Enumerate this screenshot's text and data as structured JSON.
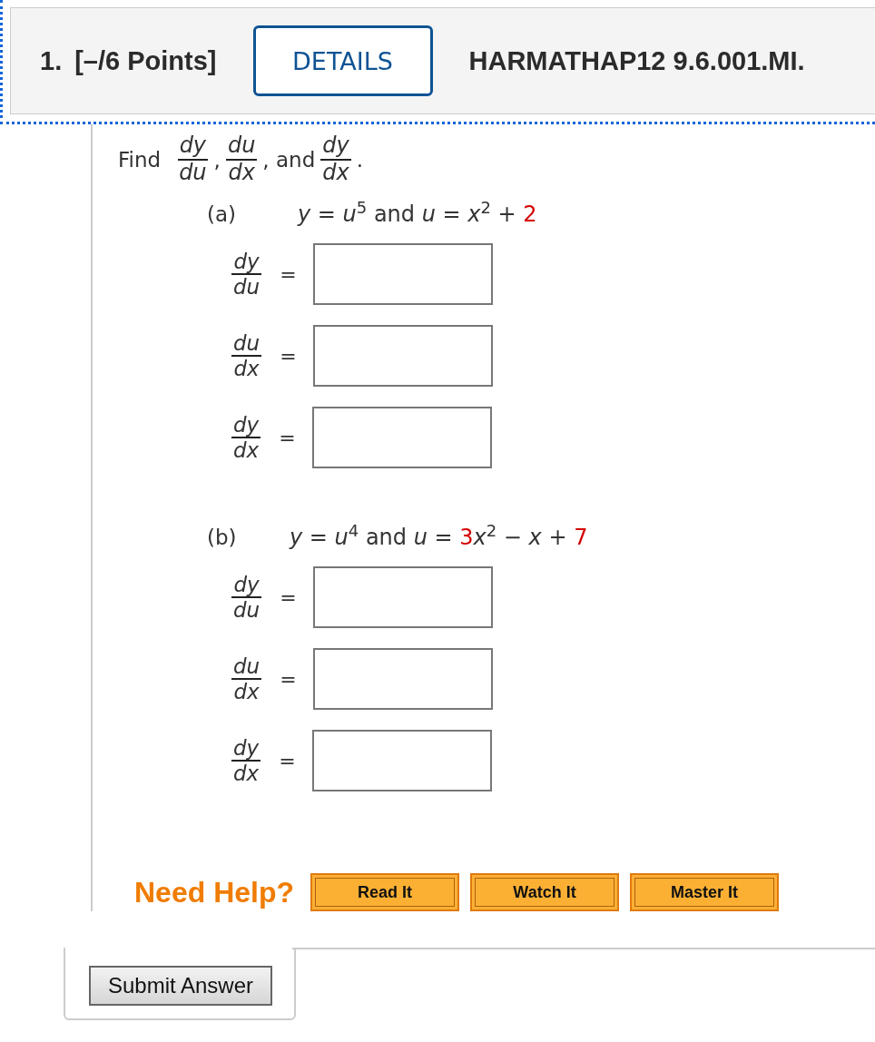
{
  "question": {
    "number": "1.",
    "points": "[–/6 Points]",
    "details_button": "DETAILS",
    "code": "HARMATHAP12 9.6.001.MI."
  },
  "prompt": {
    "lead": "Find",
    "fractions": [
      {
        "num": "dy",
        "den": "du",
        "after": ","
      },
      {
        "num": "du",
        "den": "dx",
        "after": ", and"
      },
      {
        "num": "dy",
        "den": "dx",
        "after": "."
      }
    ]
  },
  "parts": [
    {
      "label": "(a)",
      "equation": [
        {
          "text": "*y* = *u*$^{5}$ and *u* = *x*$^{2}$ + ",
          "randomized": false
        },
        {
          "text": "2",
          "randomized": true
        }
      ],
      "answers": [
        {
          "num": "dy",
          "den": "du",
          "equals": "="
        },
        {
          "num": "du",
          "den": "dx",
          "equals": "="
        },
        {
          "num": "dy",
          "den": "dx",
          "equals": "="
        }
      ]
    },
    {
      "label": "(b)",
      "equation": [
        {
          "text": "*y* = *u*$^{4}$ and *u* = ",
          "randomized": false
        },
        {
          "text": "3",
          "randomized": true
        },
        {
          "text": "*x*$^{2}$ − *x* + ",
          "randomized": false
        },
        {
          "text": "7",
          "randomized": true
        }
      ],
      "answers": [
        {
          "num": "dy",
          "den": "du",
          "equals": "="
        },
        {
          "num": "du",
          "den": "dx",
          "equals": "="
        },
        {
          "num": "dy",
          "den": "dx",
          "equals": "="
        }
      ]
    }
  ],
  "help": {
    "label": "Need Help?",
    "buttons": [
      "Read It",
      "Watch It",
      "Master It"
    ]
  },
  "submit_button": "Submit Answer"
}
